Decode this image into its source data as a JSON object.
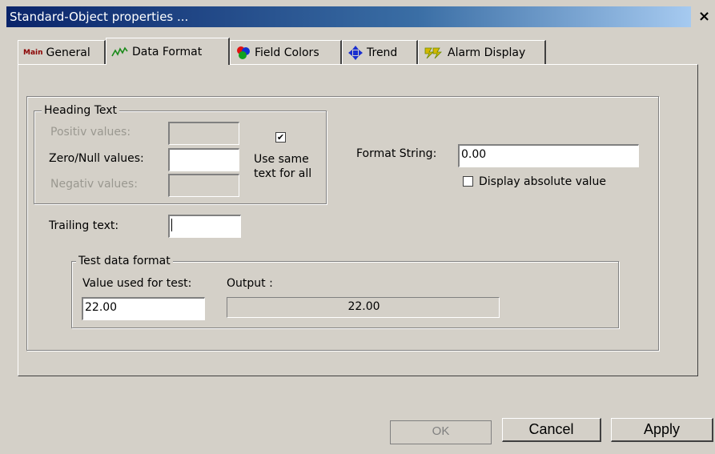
{
  "window": {
    "title": "Standard-Object properties ...",
    "close_label": "×"
  },
  "tabs": [
    {
      "label": "General",
      "icon": "main-icon",
      "icon_text": "Main"
    },
    {
      "label": "Data Format",
      "icon": "waveform-icon"
    },
    {
      "label": "Field Colors",
      "icon": "color-balls-icon"
    },
    {
      "label": "Trend",
      "icon": "arrows-cross-icon"
    },
    {
      "label": "Alarm Display",
      "icon": "alarm-lightning-icon"
    }
  ],
  "active_tab": "Data Format",
  "heading_text": {
    "legend": "Heading Text",
    "positive_label": "Positiv values:",
    "positive_value": "",
    "zero_label": "Zero/Null values:",
    "zero_value": "",
    "negative_label": "Negativ values:",
    "negative_value": "",
    "same_text_checked": true,
    "same_text_check_glyph": "✔",
    "same_text_label_line1": "Use same",
    "same_text_label_line2": "text for all"
  },
  "format": {
    "label": "Format String:",
    "value": "0.00",
    "absolute_checked": false,
    "absolute_label": "Display absolute value"
  },
  "trailing": {
    "label": "Trailing text:",
    "value": ""
  },
  "test": {
    "legend": "Test data format",
    "value_label": "Value used for test:",
    "value": "22.00",
    "output_label": "Output :",
    "output_value": "22.00"
  },
  "buttons": {
    "ok": "OK",
    "cancel": "Cancel",
    "apply": "Apply"
  }
}
